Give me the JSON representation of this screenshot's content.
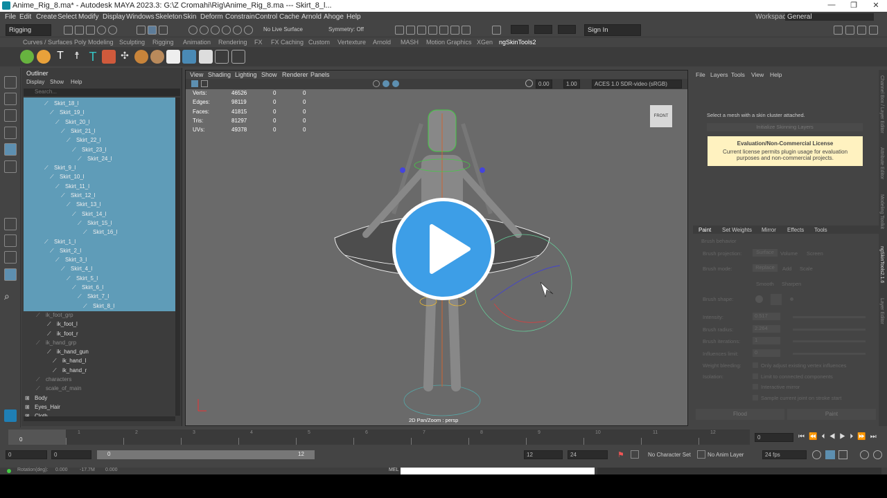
{
  "titlebar": {
    "title": "Anime_Rig_8.ma* - Autodesk MAYA 2023.3: G:\\Z Cromahi\\Rig\\Anime_Rig_8.ma   ---   Skirt_8_l...",
    "min": "—",
    "max": "❐",
    "close": "✕"
  },
  "menus": [
    "File",
    "Edit",
    "Create",
    "Select",
    "Modify",
    "Display",
    "Windows",
    "Skeleton",
    "Skin",
    "Deform",
    "Constrain",
    "Control",
    "Cache",
    "Arnold",
    "Ahoge",
    "Help"
  ],
  "workspace": {
    "label": "Workspace:",
    "value": "General"
  },
  "status": {
    "mode": "Rigging",
    "live": "No Live Surface",
    "symmetry": "Symmetry: Off",
    "signin": "Sign In"
  },
  "shelf_tabs": [
    "Curves / Surfaces",
    "Poly Modeling",
    "Sculpting",
    "Rigging",
    "Animation",
    "Rendering",
    "FX",
    "FX Caching",
    "Custom",
    "Vertexture",
    "Arnold",
    "MASH",
    "Motion Graphics",
    "XGen",
    "ngSkinTools2"
  ],
  "outliner": {
    "title": "Outliner",
    "menu": [
      "Display",
      "Show",
      "Help"
    ],
    "search": "Search...",
    "rows": [
      {
        "label": "Skirt_18_l",
        "depth": 0,
        "sel": true
      },
      {
        "label": "Skirt_19_l",
        "depth": 1,
        "sel": true
      },
      {
        "label": "Skirt_20_l",
        "depth": 2,
        "sel": true
      },
      {
        "label": "Skirt_21_l",
        "depth": 3,
        "sel": true
      },
      {
        "label": "Skirt_22_l",
        "depth": 4,
        "sel": true
      },
      {
        "label": "Skirt_23_l",
        "depth": 5,
        "sel": true
      },
      {
        "label": "Skirt_24_l",
        "depth": 6,
        "sel": true
      },
      {
        "label": "Skirt_9_l",
        "depth": 0,
        "sel": true
      },
      {
        "label": "Skirt_10_l",
        "depth": 1,
        "sel": true
      },
      {
        "label": "Skirt_11_l",
        "depth": 2,
        "sel": true
      },
      {
        "label": "Skirt_12_l",
        "depth": 3,
        "sel": true
      },
      {
        "label": "Skirt_13_l",
        "depth": 4,
        "sel": true
      },
      {
        "label": "Skirt_14_l",
        "depth": 5,
        "sel": true
      },
      {
        "label": "Skirt_15_l",
        "depth": 6,
        "sel": true
      },
      {
        "label": "Skirt_16_l",
        "depth": 7,
        "sel": true
      },
      {
        "label": "Skirt_1_l",
        "depth": 0,
        "sel": true
      },
      {
        "label": "Skirt_2_l",
        "depth": 1,
        "sel": true
      },
      {
        "label": "Skirt_3_l",
        "depth": 2,
        "sel": true
      },
      {
        "label": "Skirt_4_l",
        "depth": 3,
        "sel": true
      },
      {
        "label": "Skirt_5_l",
        "depth": 4,
        "sel": true
      },
      {
        "label": "Skirt_6_l",
        "depth": 5,
        "sel": true
      },
      {
        "label": "Skirt_7_l",
        "depth": 6,
        "sel": true
      },
      {
        "label": "Skirt_8_l",
        "depth": 7,
        "sel": true
      },
      {
        "label": "ik_foot_grp",
        "depth": -1,
        "sel": false
      },
      {
        "label": "ik_foot_l",
        "depth": 0,
        "sel": false
      },
      {
        "label": "ik_foot_r",
        "depth": 0,
        "sel": false
      },
      {
        "label": "ik_hand_grp",
        "depth": -1,
        "sel": false
      },
      {
        "label": "ik_hand_gun",
        "depth": 0,
        "sel": false
      },
      {
        "label": "ik_hand_l",
        "depth": 1,
        "sel": false
      },
      {
        "label": "ik_hand_r",
        "depth": 1,
        "sel": false
      },
      {
        "label": "characters",
        "depth": -1,
        "sel": false
      },
      {
        "label": "scale_of_main",
        "depth": -1,
        "sel": false
      },
      {
        "label": "Body",
        "depth": -2,
        "sel": false
      },
      {
        "label": "Eyes_Hair",
        "depth": -2,
        "sel": false
      },
      {
        "label": "Cloth",
        "depth": -2,
        "sel": false
      }
    ]
  },
  "viewport": {
    "menu": [
      "View",
      "Shading",
      "Lighting",
      "Show",
      "Renderer",
      "Panels"
    ],
    "exposure": "0.00",
    "gamma": "1.00",
    "colorspace": "ACES 1.0 SDR-video (sRGB)",
    "cube": "FRONT",
    "label": "2D Pan/Zoom : persp",
    "hud": [
      {
        "k": "Verts:",
        "v": "46526",
        "a": "0",
        "b": "0"
      },
      {
        "k": "Edges:",
        "v": "98119",
        "a": "0",
        "b": "0"
      },
      {
        "k": "Faces:",
        "v": "41815",
        "a": "0",
        "b": "0"
      },
      {
        "k": "Tris:",
        "v": "81297",
        "a": "0",
        "b": "0"
      },
      {
        "k": "UVs:",
        "v": "49378",
        "a": "0",
        "b": "0"
      }
    ]
  },
  "right": {
    "menu": [
      "File",
      "Layers",
      "Tools",
      "View",
      "Help"
    ],
    "hint": "Select a mesh with a skin cluster attached.",
    "init": "Initialize Skinning Layers",
    "license_title": "Evaluation/Non-Commercial License",
    "license_text": "Current license permits plugin usage for evaluation purposes and non-commercial projects.",
    "tabs": [
      "Paint",
      "Set Weights",
      "Mirror",
      "Effects",
      "Tools"
    ],
    "section": "Brush behavior",
    "projection": "Brush projection:",
    "proj_opts": [
      "Surface",
      "Volume",
      "Screen"
    ],
    "mode": "Brush mode:",
    "mode_opts": [
      "Replace",
      "Add",
      "Scale"
    ],
    "mode_opts2": [
      "Smooth",
      "Sharpen"
    ],
    "shape": "Brush shape:",
    "rows": [
      {
        "k": "Intensity:",
        "v": "0.517"
      },
      {
        "k": "Brush radius:",
        "v": "2.264"
      },
      {
        "k": "Brush iterations:",
        "v": "1"
      },
      {
        "k": "Influences limit:",
        "v": "0"
      }
    ],
    "checks": [
      {
        "k": "Weight bleeding:",
        "v": "Only adjust existing vertex influences"
      },
      {
        "k": "Isolation:",
        "v": "Limit to connected components"
      },
      {
        "k": "",
        "v": "Interactive mirror"
      },
      {
        "k": "",
        "v": "Sample current joint on stroke start"
      }
    ],
    "flood": "Flood",
    "paint": "Paint"
  },
  "sidetabs": [
    "Channel Box / Layer Editor",
    "Attribute Editor",
    "Modeling Toolkit",
    "ngSkinTools2.1.6",
    "Layer Editor"
  ],
  "timeline": {
    "ticks": [
      "1",
      "2",
      "3",
      "4",
      "5",
      "6",
      "7",
      "8",
      "9",
      "10",
      "11",
      "12"
    ],
    "current": "0",
    "frame": "0"
  },
  "range": {
    "start": "0",
    "start2": "0",
    "inner_start": "0",
    "inner_end": "12",
    "end": "12",
    "end2": "24",
    "character": "No Character Set",
    "anim": "No Anim Layer",
    "fps": "24 fps"
  },
  "cmd": {
    "lang": "MEL",
    "label": "Rotation(deg):",
    "v1": "0.000",
    "v2": "-17.7M",
    "v3": "0.000"
  },
  "colors": {
    "selection": "#5f9cb8",
    "play": "#3d9ee7",
    "license": "#fff2c0"
  }
}
